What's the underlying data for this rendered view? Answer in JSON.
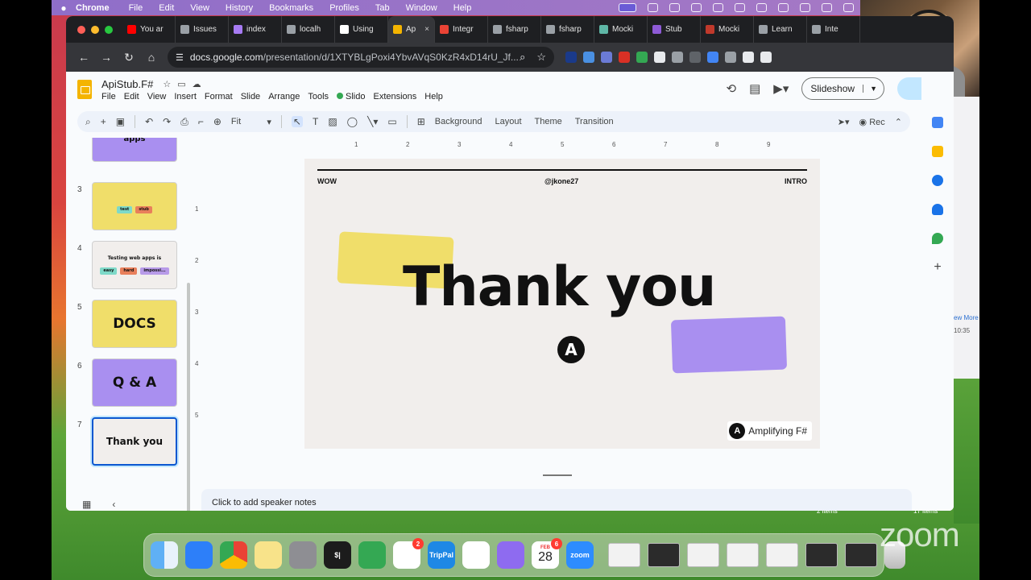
{
  "menubar": {
    "app_name": "Chrome",
    "items": [
      "File",
      "Edit",
      "View",
      "History",
      "Bookmarks",
      "Profiles",
      "Tab",
      "Window",
      "Help"
    ]
  },
  "browser": {
    "tabs": [
      {
        "label": "You ar",
        "color": "#ff0000"
      },
      {
        "label": "Issues",
        "color": "#9aa0a6"
      },
      {
        "label": "index",
        "color": "#a77bf3"
      },
      {
        "label": "localh",
        "color": "#9aa0a6"
      },
      {
        "label": "Using",
        "color": "#ffffff"
      },
      {
        "label": "Ap",
        "color": "#f4b400",
        "active": true
      },
      {
        "label": "Integr",
        "color": "#ea4335"
      },
      {
        "label": "fsharp",
        "color": "#9aa0a6"
      },
      {
        "label": "fsharp",
        "color": "#9aa0a6"
      },
      {
        "label": "Mocki",
        "color": "#5fb7a6"
      },
      {
        "label": "Stub",
        "color": "#8e5bd6"
      },
      {
        "label": "Mocki",
        "color": "#c0392b"
      },
      {
        "label": "Learn",
        "color": "#9aa0a6"
      },
      {
        "label": "Inte",
        "color": "#9aa0a6"
      }
    ],
    "url_host": "docs.google.com",
    "url_path": "/presentation/d/1XTYBLgPoxi4YbvAVqS0KzR4xD14rU_Jf..."
  },
  "slides_app": {
    "doc_title": "ApiStub.F#",
    "menus": [
      "File",
      "Edit",
      "View",
      "Insert",
      "Format",
      "Slide",
      "Arrange",
      "Tools",
      "Slido",
      "Extensions",
      "Help"
    ],
    "slideshow_label": "Slideshow",
    "zoom_value": "Fit",
    "toolbar_text": [
      "Background",
      "Layout",
      "Theme",
      "Transition"
    ],
    "rec_label": "Rec",
    "speaker_notes_placeholder": "Click to add speaker notes",
    "filmstrip": [
      {
        "num": "",
        "text": "DSL\nFor web .net\napps",
        "bg": "#a98ff0"
      },
      {
        "num": "3",
        "text": "",
        "bg": "#f0de6a",
        "tags": [
          "test",
          "stub"
        ]
      },
      {
        "num": "4",
        "text": "Testing web apps is",
        "bg": "#f1eeec",
        "tags": [
          "easy",
          "hard",
          "impossi..."
        ]
      },
      {
        "num": "5",
        "text": "DOCS",
        "bg": "#f0de6a"
      },
      {
        "num": "6",
        "text": "Q & A",
        "bg": "#a98ff0"
      },
      {
        "num": "7",
        "text": "Thank you",
        "bg": "#f1eeec",
        "selected": true
      }
    ],
    "ruler_h": [
      "1",
      "2",
      "3",
      "4",
      "5",
      "6",
      "7",
      "8",
      "9"
    ],
    "ruler_v": [
      "1",
      "2",
      "3",
      "4",
      "5"
    ],
    "slide": {
      "top_left": "WOW",
      "top_center": "@jkone27",
      "top_right": "INTRO",
      "title": "Thank you",
      "logo_letter": "A",
      "brand_text": "Amplifying F#",
      "accent_yellow": "#f0de6a",
      "accent_purple": "#a98ff0"
    }
  },
  "desktop": {
    "side_text_1": "ew More",
    "side_text_2": "10:35",
    "label_1": "2 items",
    "label_2": "17 items",
    "watermark": "zoom"
  },
  "dock": {
    "apps": [
      {
        "name": "finder",
        "color": "#3a8ee6",
        "label": ""
      },
      {
        "name": "mail",
        "color": "#2d7ff9",
        "label": ""
      },
      {
        "name": "chrome",
        "color": "#ffffff",
        "label": ""
      },
      {
        "name": "notes",
        "color": "#f8e38a",
        "label": ""
      },
      {
        "name": "settings",
        "color": "#8e8e93",
        "label": ""
      },
      {
        "name": "terminal",
        "color": "#1c1c1c",
        "label": "$|"
      },
      {
        "name": "messages",
        "color": "#34a853",
        "label": ""
      },
      {
        "name": "slack",
        "color": "#ffffff",
        "label": "",
        "badge": "2"
      },
      {
        "name": "trippal",
        "color": "#1e88e5",
        "label": "TripPal"
      },
      {
        "name": "vscode",
        "color": "#ffffff",
        "label": ""
      },
      {
        "name": "orb",
        "color": "#8e6bf0",
        "label": ""
      },
      {
        "name": "calendar",
        "color": "#ffffff",
        "label": "28",
        "month": "FEB",
        "badge": "6"
      },
      {
        "name": "zoom",
        "color": "#2d8cff",
        "label": "zoom"
      }
    ]
  }
}
